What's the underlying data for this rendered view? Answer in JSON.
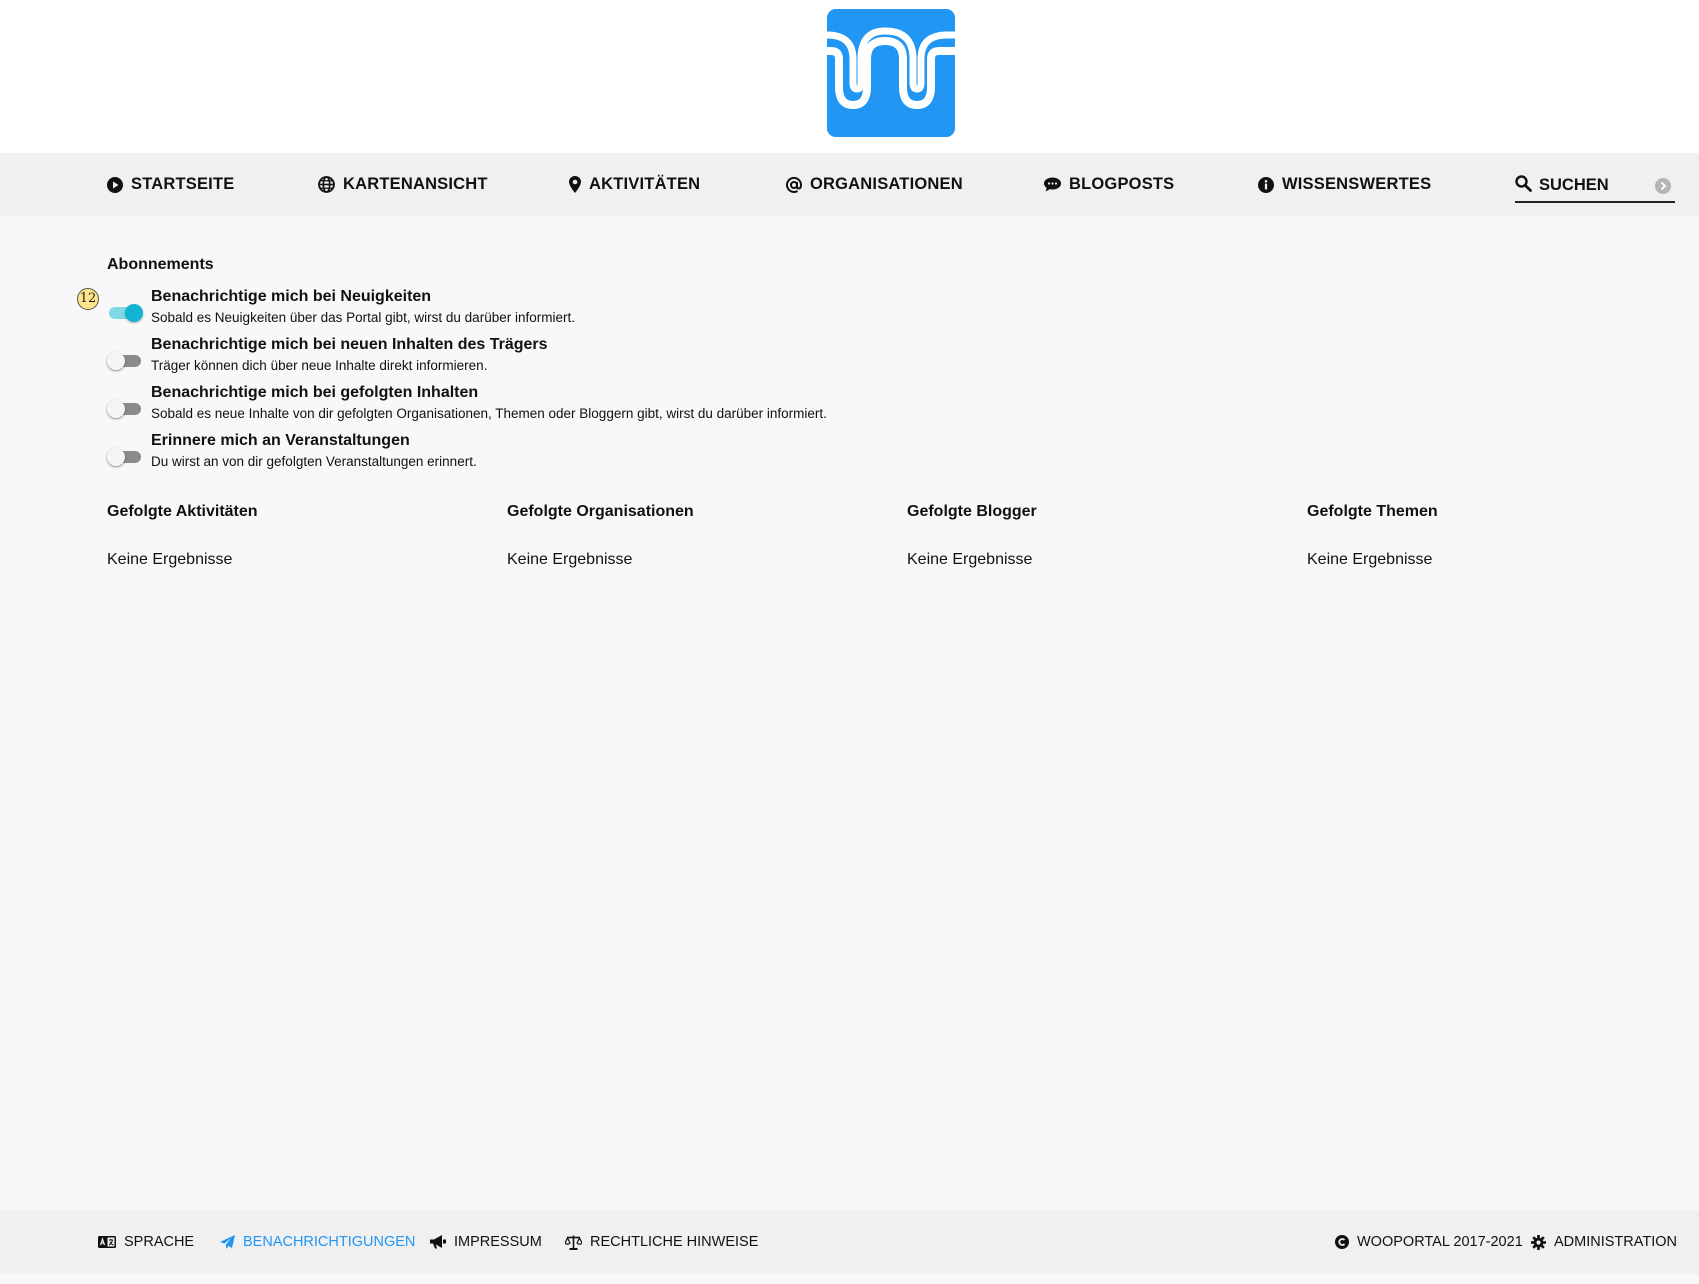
{
  "nav": {
    "items": [
      {
        "label": "STARTSEITE",
        "icon": "play-circle-icon"
      },
      {
        "label": "KARTENANSICHT",
        "icon": "globe-icon"
      },
      {
        "label": "AKTIVITÄTEN",
        "icon": "map-marker-icon"
      },
      {
        "label": "ORGANISATIONEN",
        "icon": "at-icon"
      },
      {
        "label": "BLOGPOSTS",
        "icon": "comment-icon"
      },
      {
        "label": "WISSENSWERTES",
        "icon": "info-circle-icon"
      }
    ],
    "search": {
      "placeholder": "SUCHEN",
      "value": ""
    }
  },
  "subscriptions": {
    "title": "Abonnements",
    "badge": "12",
    "items": [
      {
        "title": "Benachrichtige mich bei Neuigkeiten",
        "description": "Sobald es Neuigkeiten über das Portal gibt, wirst du darüber informiert.",
        "enabled": true
      },
      {
        "title": "Benachrichtige mich bei neuen Inhalten des Trägers",
        "description": "Träger können dich über neue Inhalte direkt informieren.",
        "enabled": false
      },
      {
        "title": "Benachrichtige mich bei gefolgten Inhalten",
        "description": "Sobald es neue Inhalte von dir gefolgten Organisationen, Themen oder Bloggern gibt, wirst du darüber informiert.",
        "enabled": false
      },
      {
        "title": "Erinnere mich an Veranstaltungen",
        "description": "Du wirst an von dir gefolgten Veranstaltungen erinnert.",
        "enabled": false
      }
    ]
  },
  "followed": [
    {
      "title": "Gefolgte Aktivitäten",
      "empty": "Keine Ergebnisse"
    },
    {
      "title": "Gefolgte Organisationen",
      "empty": "Keine Ergebnisse"
    },
    {
      "title": "Gefolgte Blogger",
      "empty": "Keine Ergebnisse"
    },
    {
      "title": "Gefolgte Themen",
      "empty": "Keine Ergebnisse"
    }
  ],
  "footer": {
    "items": [
      {
        "label": "SPRACHE",
        "icon": "language-icon"
      },
      {
        "label": "BENACHRICHTIGUNGEN",
        "icon": "paper-plane-icon",
        "active": true
      },
      {
        "label": "IMPRESSUM",
        "icon": "bullhorn-icon"
      },
      {
        "label": "RECHTLICHE HINWEISE",
        "icon": "balance-scale-icon"
      }
    ],
    "copyright": "WOOPORTAL 2017-2021",
    "admin": "ADMINISTRATION"
  },
  "colors": {
    "brand": "#2196f3",
    "toggle_on": "#12b4d2",
    "active_link": "#2196f3"
  }
}
